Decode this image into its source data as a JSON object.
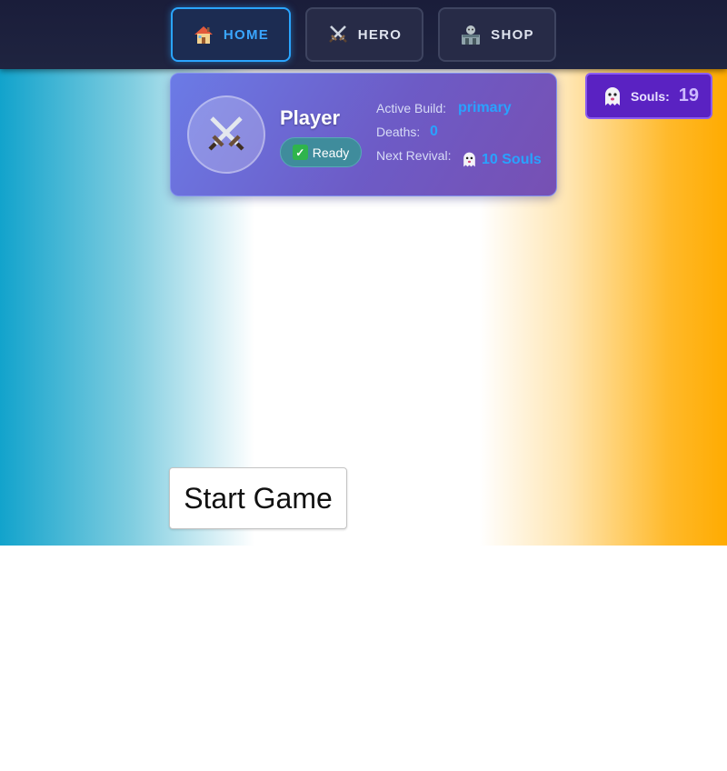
{
  "nav": {
    "items": [
      {
        "label": "HOME",
        "icon": "house-icon",
        "active": true
      },
      {
        "label": "HERO",
        "icon": "crossed-swords-icon",
        "active": false
      },
      {
        "label": "SHOP",
        "icon": "shop-icon",
        "active": false
      }
    ]
  },
  "player": {
    "name": "Player",
    "avatar_icon": "crossed-swords-icon",
    "status": "Ready",
    "stats": {
      "active_build_label": "Active Build:",
      "active_build_value": "primary",
      "deaths_label": "Deaths:",
      "deaths_value": "0",
      "next_revival_label": "Next Revival:",
      "next_revival_value": "10 Souls"
    }
  },
  "souls": {
    "label": "Souls:",
    "value": "19",
    "icon": "ghost-icon"
  },
  "start_button": {
    "label": "Start Game"
  },
  "colors": {
    "accent": "#2aa5ff",
    "stat_value": "#29a2ff",
    "nav_bg": "#1a1d3a",
    "card_start": "#6b7be6",
    "card_end": "#7750b3",
    "souls_bg": "#5a22c2",
    "status_badge": "#3f8c9c",
    "gradient_left": "#12a3cc",
    "gradient_right": "#ffab00"
  }
}
